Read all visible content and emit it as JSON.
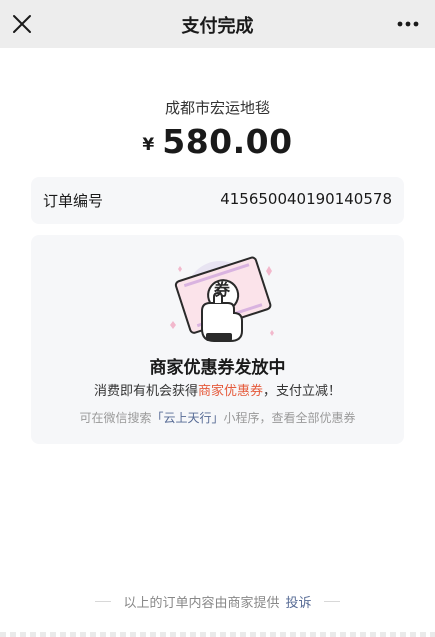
{
  "nav": {
    "title": "支付完成",
    "close_icon": "close-icon",
    "more_icon": "more-icon"
  },
  "payment": {
    "merchant": "成都市宏运地毯",
    "currency": "¥",
    "amount": "580.00"
  },
  "order": {
    "label": "订单编号",
    "number": "415650040190140578"
  },
  "coupon": {
    "illustration_icon": "coupon-hand-icon",
    "illustration_text": "券",
    "title": "商家优惠券发放中",
    "desc_prefix": "消费即有机会获得",
    "desc_highlight": "商家优惠券",
    "desc_suffix": "，支付立减！",
    "tip_prefix": "可在微信搜索",
    "tip_link": "「云上天行」",
    "tip_suffix": "小程序，查看全部优惠券",
    "highlight_color": "#e55a3b",
    "link_color": "#576b95"
  },
  "footer": {
    "text": "以上的订单内容由商家提供",
    "link": "投诉"
  }
}
